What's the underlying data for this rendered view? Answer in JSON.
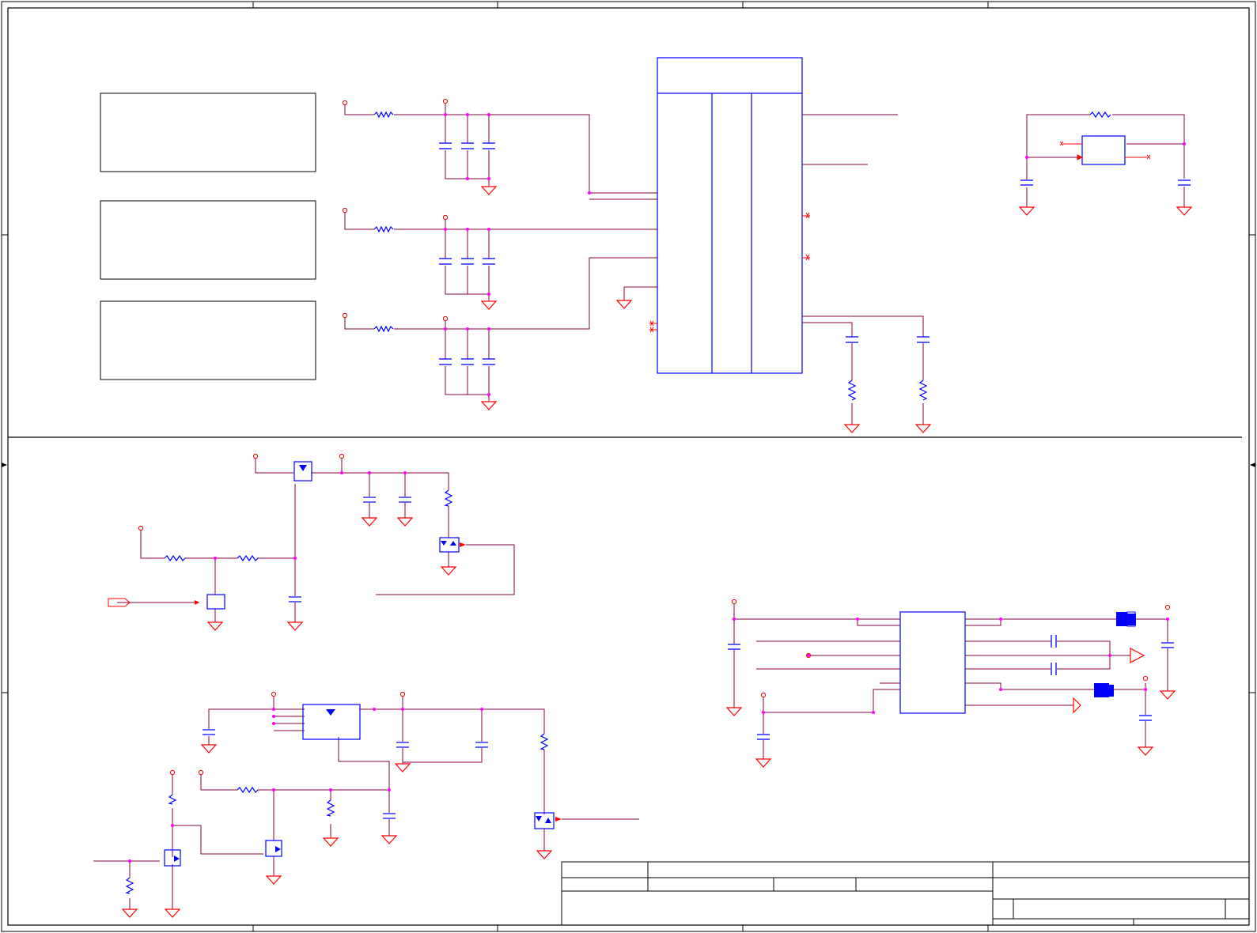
{
  "sheet": {
    "kind": "electrical schematic",
    "labels_present": false,
    "colors": {
      "border": "#000000",
      "wire": "#800040",
      "component": "#0000ff",
      "power": "#ff0000",
      "junction": "#ff00ff",
      "title_block_fill": "#0000ff"
    }
  },
  "regions": {
    "power_section": {
      "notes_boxes": 3,
      "filter_rails": 3,
      "main_ic": 1,
      "crystal_block": 1
    },
    "switch_section_1": {
      "mosfets": 2,
      "tvs": 1
    },
    "switch_section_2": {
      "mosfets": 3,
      "tvs": 1,
      "load_switch_ic": 1
    },
    "interface_section": {
      "ic": 1,
      "connectors": 2
    }
  },
  "icons": {
    "power_port": "circle-port-icon",
    "ground": "ground-triangle-icon",
    "resistor": "zigzag-resistor-icon",
    "capacitor": "capacitor-plates-icon",
    "inductor": "ferrite-bead-icon",
    "mosfet": "mosfet-icon",
    "tvs": "tvs-diode-icon",
    "no_connect": "no-connect-x-icon",
    "off_sheet": "off-sheet-arrow-icon"
  }
}
